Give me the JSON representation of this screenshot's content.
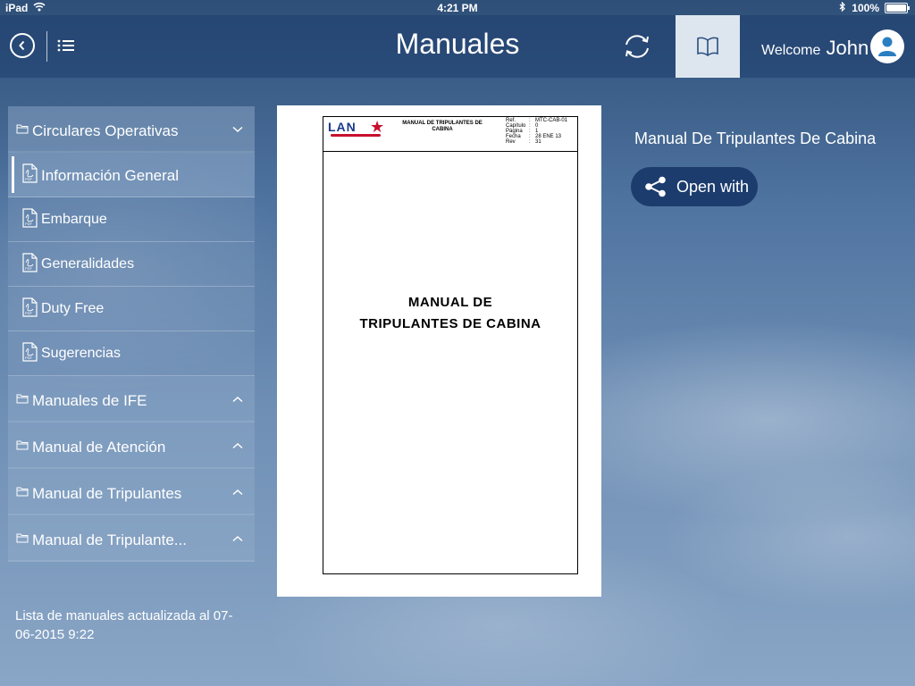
{
  "status_bar": {
    "device": "iPad",
    "time": "4:21 PM",
    "battery": "100%"
  },
  "header": {
    "title": "Manuales",
    "welcome_label": "Welcome",
    "user_name": "John"
  },
  "sidebar": {
    "sections": [
      {
        "label": "Circulares Operativas",
        "expanded": true,
        "items": [
          {
            "label": "Información General",
            "active": true
          },
          {
            "label": "Embarque"
          },
          {
            "label": "Generalidades"
          },
          {
            "label": "Duty Free"
          },
          {
            "label": "Sugerencias"
          }
        ]
      },
      {
        "label": "Manuales de IFE",
        "expanded": false
      },
      {
        "label": "Manual de Atención",
        "expanded": false
      },
      {
        "label": "Manual de Tripulantes",
        "expanded": false
      },
      {
        "label": "Manual de Tripulante...",
        "expanded": false
      }
    ],
    "updated_text": "Lista de manuales actualizada al 07-06-2015 9:22"
  },
  "document": {
    "logo_text": "LAN",
    "header_title": "MANUAL DE TRIPULANTES DE CABINA",
    "fields": [
      {
        "key": "Ref.",
        "value": "MTC-CAB-01"
      },
      {
        "key": "Capítulo",
        "value": "0"
      },
      {
        "key": "Página",
        "value": "1"
      },
      {
        "key": "Fecha",
        "value": "28 ENE 13"
      },
      {
        "key": "Rev",
        "value": "31"
      }
    ],
    "main_title_line1": "MANUAL DE",
    "main_title_line2": "TRIPULANTES DE CABINA"
  },
  "detail": {
    "title": "Manual De Tripulantes De Cabina",
    "open_with_label": "Open with"
  },
  "colors": {
    "header_bg": "#1e3e6e",
    "open_with_bg": "#1c3c6e",
    "book_tab_bg": "#dde6ef",
    "logo_red": "#c8102e",
    "logo_blue": "#1a3a8a"
  }
}
